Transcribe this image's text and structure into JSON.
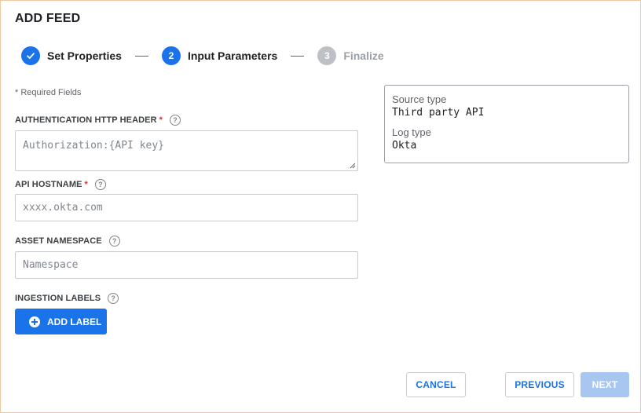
{
  "dialog": {
    "title": "ADD FEED"
  },
  "stepper": {
    "steps": [
      {
        "number": "",
        "label": "Set Properties",
        "state": "done"
      },
      {
        "number": "2",
        "label": "Input Parameters",
        "state": "active"
      },
      {
        "number": "3",
        "label": "Finalize",
        "state": "pending"
      }
    ]
  },
  "form": {
    "required_note": "* Required Fields",
    "fields": [
      {
        "label": "AUTHENTICATION HTTP HEADER",
        "required_mark": "*",
        "placeholder": "Authorization:{API key}"
      },
      {
        "label": "API HOSTNAME",
        "required_mark": "*",
        "placeholder": "xxxx.okta.com"
      },
      {
        "label": "ASSET NAMESPACE",
        "placeholder": "Namespace"
      },
      {
        "label": "INGESTION LABELS"
      }
    ],
    "help_glyph": "?",
    "add_label_button": "ADD LABEL"
  },
  "info": {
    "source_type_label": "Source type",
    "source_type_value": "Third party API",
    "log_type_label": "Log type",
    "log_type_value": "Okta"
  },
  "footer": {
    "cancel": "CANCEL",
    "previous": "PREVIOUS",
    "next": "NEXT"
  },
  "colors": {
    "accent": "#1a73e8",
    "required": "#d93025",
    "disabled_button": "#a8c7f0",
    "frame_border": "#f0c9a0"
  },
  "icons": {
    "step1": "checkmark-icon",
    "help": "help-circle-icon",
    "add": "add-circle-icon",
    "resize": "resize-handle-icon"
  }
}
